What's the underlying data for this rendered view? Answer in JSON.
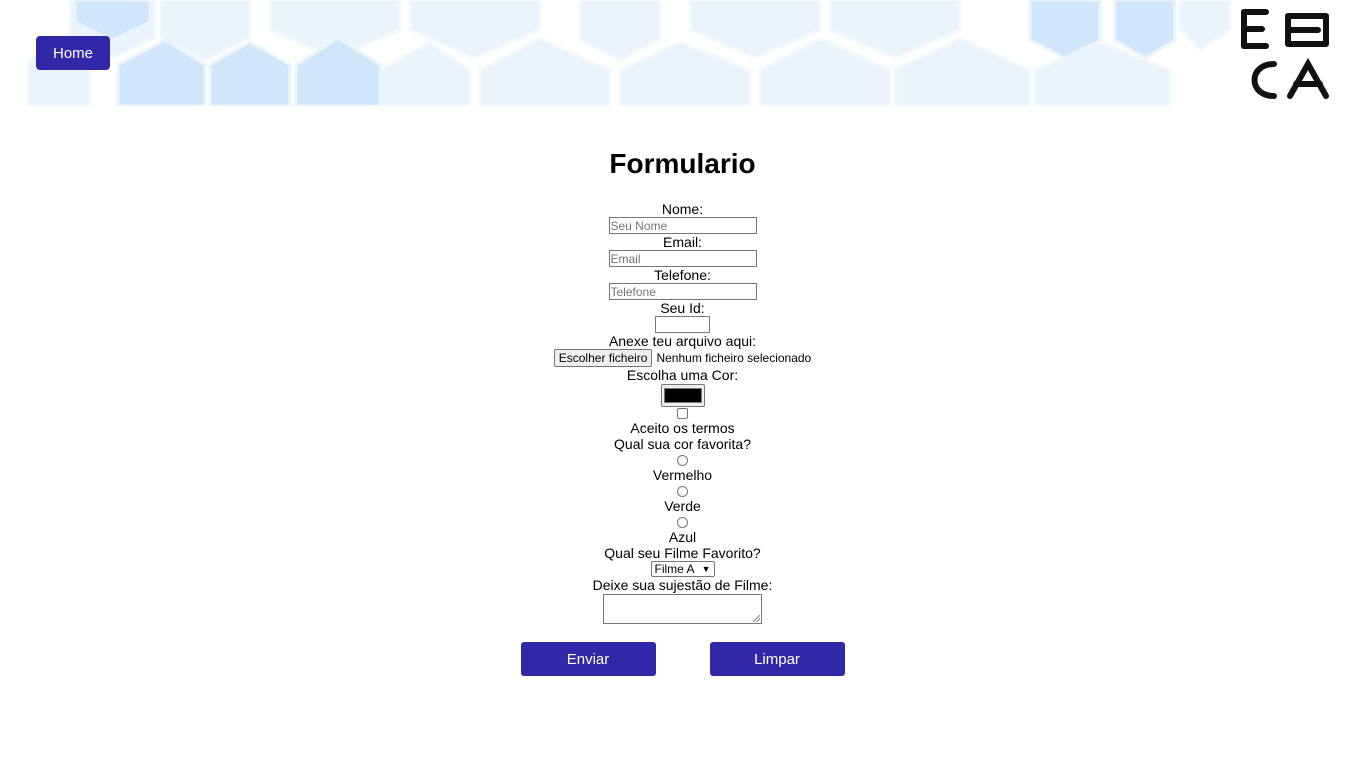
{
  "header": {
    "home_label": "Home",
    "logo_name": "ebac-logo"
  },
  "page": {
    "title": "Formulario"
  },
  "form": {
    "nome_label": "Nome:",
    "nome_placeholder": "Seu Nome",
    "email_label": "Email:",
    "email_placeholder": "Email",
    "telefone_label": "Telefone:",
    "telefone_placeholder": "Telefone",
    "id_label": "Seu Id:",
    "arquivo_label": "Anexe teu arquivo aqui:",
    "arquivo_button": "Escolher ficheiro",
    "arquivo_status": "Nenhum ficheiro selecionado",
    "cor_label": "Escolha uma Cor:",
    "cor_value": "#000000",
    "termos_label": "Aceito os termos",
    "cor_favorita_label": "Qual sua cor favorita?",
    "radio_options": [
      "Vermelho",
      "Verde",
      "Azul"
    ],
    "filme_label": "Qual seu Filme Favorito?",
    "filme_selected": "Filme A",
    "sugestao_label": "Deixe sua sujestão de Filme:",
    "enviar_label": "Enviar",
    "limpar_label": "Limpar"
  },
  "colors": {
    "accent": "#3128a8",
    "hex_light": "#e8f4fc",
    "hex_mid": "#cfe6fb"
  }
}
